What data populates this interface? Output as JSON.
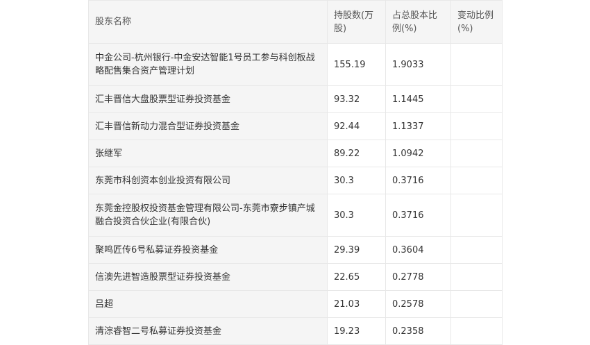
{
  "table": {
    "headers": [
      "股东名称",
      "持股数(万股)",
      "占总股本比例(%)",
      "变动比例(%)"
    ],
    "rows": [
      {
        "name": "中金公司-杭州银行-中金安达智能1号员工参与科创板战略配售集合资产管理计划",
        "shares": "155.19",
        "ratio": "1.9033",
        "change": ""
      },
      {
        "name": "汇丰晋信大盘股票型证券投资基金",
        "shares": "93.32",
        "ratio": "1.1445",
        "change": ""
      },
      {
        "name": "汇丰晋信新动力混合型证券投资基金",
        "shares": "92.44",
        "ratio": "1.1337",
        "change": ""
      },
      {
        "name": "张继军",
        "shares": "89.22",
        "ratio": "1.0942",
        "change": ""
      },
      {
        "name": "东莞市科创资本创业投资有限公司",
        "shares": "30.3",
        "ratio": "0.3716",
        "change": ""
      },
      {
        "name": "东莞金控股权投资基金管理有限公司-东莞市寮步镇产城融合投资合伙企业(有限合伙)",
        "shares": "30.3",
        "ratio": "0.3716",
        "change": ""
      },
      {
        "name": "聚鸣匠传6号私募证券投资基金",
        "shares": "29.39",
        "ratio": "0.3604",
        "change": ""
      },
      {
        "name": "信澳先进智造股票型证券投资基金",
        "shares": "22.65",
        "ratio": "0.2778",
        "change": ""
      },
      {
        "name": "吕超",
        "shares": "21.03",
        "ratio": "0.2578",
        "change": ""
      },
      {
        "name": "清淙睿智二号私募证券投资基金",
        "shares": "19.23",
        "ratio": "0.2358",
        "change": ""
      }
    ]
  }
}
